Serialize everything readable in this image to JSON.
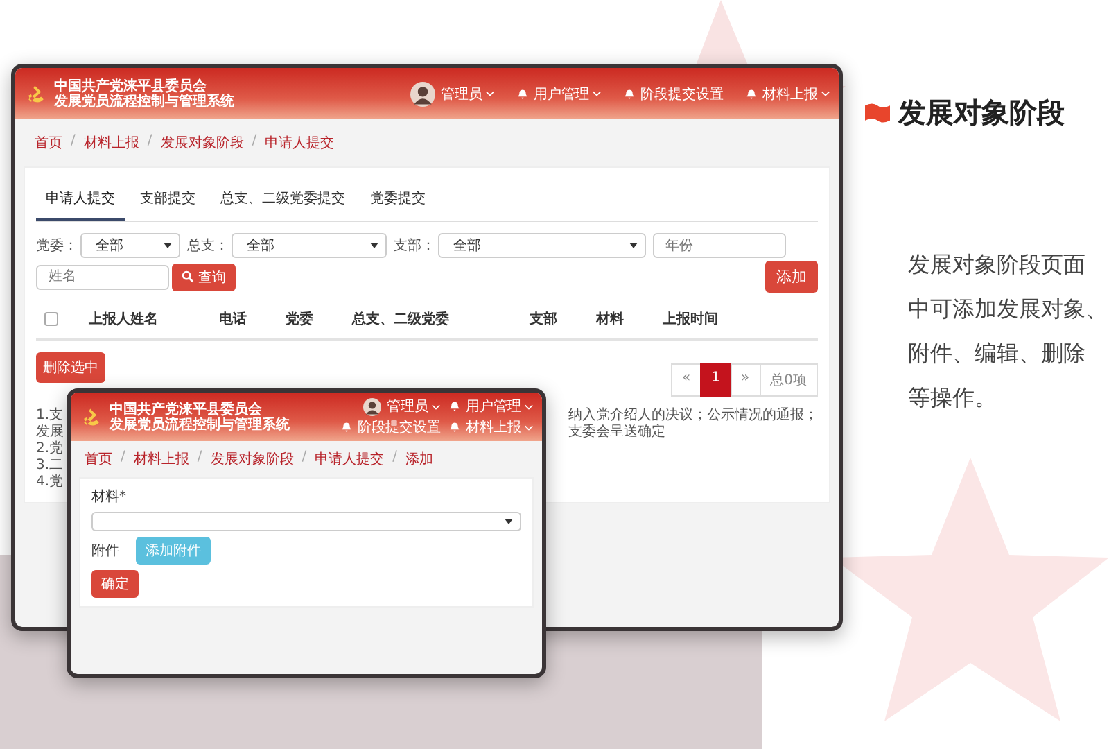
{
  "windows": [
    {
      "kind": "list",
      "header": {
        "title_lines": [
          "中国共产党涞平县委员会",
          "发展党员流程控制与管理系统"
        ],
        "user": {
          "label": "管理员",
          "dropdown": true
        },
        "nav": [
          {
            "label": "用户管理",
            "bell": true,
            "dropdown": true
          },
          {
            "label": "阶段提交设置",
            "bell": true,
            "dropdown": false
          },
          {
            "label": "材料上报",
            "bell": true,
            "dropdown": true
          }
        ]
      },
      "breadcrumb": [
        "首页",
        "材料上报",
        "发展对象阶段",
        "申请人提交"
      ],
      "breadcrumb_separator": "/",
      "tabs": [
        {
          "label": "申请人提交",
          "selected": true
        },
        {
          "label": "支部提交",
          "selected": false
        },
        {
          "label": "总支、二级党委提交",
          "selected": false
        },
        {
          "label": "党委提交",
          "selected": false
        }
      ],
      "filters": [
        {
          "label": "党委：",
          "value": "全部"
        },
        {
          "label": "总支：",
          "value": "全部"
        },
        {
          "label": "支部：",
          "value": "全部"
        }
      ],
      "year_placeholder": "年份",
      "name_placeholder": "姓名",
      "search_button": "查询",
      "add_button": "添加",
      "table": {
        "select_all_checked": false,
        "columns": [
          "上报人姓名",
          "电话",
          "党委",
          "总支、二级党委",
          "支部",
          "材料",
          "上报时间"
        ]
      },
      "delete_button": "删除选中",
      "pagination": {
        "prev": "«",
        "pages": [
          {
            "label": "1",
            "selected": true
          }
        ],
        "next": "»",
        "total": "总0项"
      },
      "notes_left": [
        "1.支",
        "发展",
        "2.党",
        "3.二",
        "4.党"
      ],
      "notes_right": "纳入党介绍人的决议；公示情况的通报；支委会呈送确定"
    },
    {
      "kind": "form",
      "header": {
        "title_lines": [
          "中国共产党涞平县委员会",
          "发展党员流程控制与管理系统"
        ],
        "user": {
          "label": "管理员",
          "dropdown": true
        },
        "nav": [
          {
            "label": "用户管理",
            "bell": true,
            "dropdown": true
          },
          {
            "label": "阶段提交设置",
            "bell": true,
            "dropdown": false
          },
          {
            "label": "材料上报",
            "bell": true,
            "dropdown": true
          }
        ]
      },
      "breadcrumb": [
        "首页",
        "材料上报",
        "发展对象阶段",
        "申请人提交",
        "添加"
      ],
      "breadcrumb_separator": "/",
      "material_label": "材料*",
      "attachment_label": "附件",
      "attach_button": "添加附件",
      "confirm_button": "确定"
    }
  ],
  "promo": {
    "title": "发展对象阶段",
    "description_lines": [
      "发展对象阶段页面",
      "中可添加发展对象、",
      "附件、编辑、删除",
      "等操作。"
    ]
  }
}
